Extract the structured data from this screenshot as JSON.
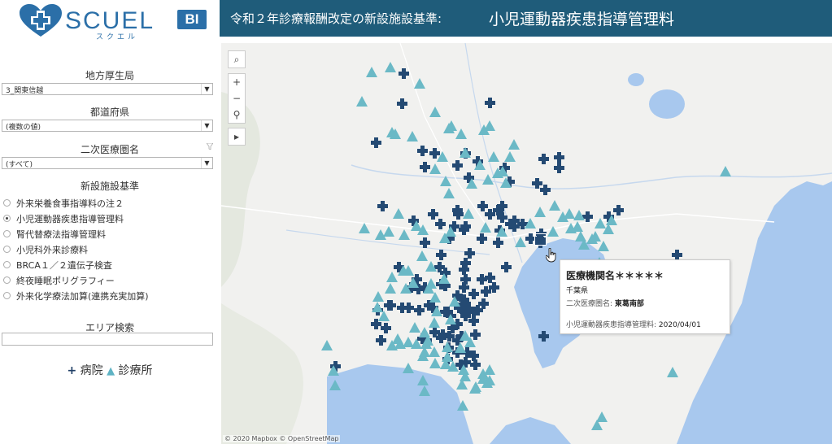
{
  "logo": {
    "brand": "SCUEL",
    "badge": "BI",
    "kana": "スクエル"
  },
  "header": {
    "title": "令和２年診療報酬改定の新設施設基準:",
    "subtitle": "小児運動器疾患指導管理料"
  },
  "filters": {
    "region": {
      "label": "地方厚生局",
      "value": "3_関東信越"
    },
    "prefecture": {
      "label": "都道府県",
      "value": "(複数の値)"
    },
    "medical_area": {
      "label": "二次医療圏名",
      "value": "(すべて)"
    }
  },
  "criteria": {
    "label": "新設施設基準",
    "options": [
      {
        "label": "外来栄養食事指導料の注２",
        "selected": false
      },
      {
        "label": "小児運動器疾患指導管理料",
        "selected": true
      },
      {
        "label": "腎代替療法指導管理料",
        "selected": false
      },
      {
        "label": "小児科外来診療料",
        "selected": false
      },
      {
        "label": "BRCA１／２遺伝子検査",
        "selected": false
      },
      {
        "label": "終夜睡眠ポリグラフィー",
        "selected": false
      },
      {
        "label": "外来化学療法加算(連携充実加算)",
        "selected": false
      }
    ]
  },
  "area_search": {
    "label": "エリア検索",
    "value": ""
  },
  "legend": {
    "hospital": "病院",
    "clinic": "診療所",
    "hospital_color": "#244a73",
    "clinic_color": "#6bb9c6"
  },
  "map": {
    "attribution": "© 2020 Mapbox © OpenStreetMap",
    "controls": [
      "search-icon",
      "zoom-in-icon",
      "zoom-out-icon",
      "pin-icon",
      "expand-icon"
    ]
  },
  "tooltip": {
    "name": "医療機関名＊＊＊＊＊",
    "prefecture": "千葉県",
    "area_label": "二次医療圏名:",
    "area_value": "東葛南部",
    "criterion_label": "小児運動器疾患指導管理料:",
    "criterion_date": "2020/04/01"
  }
}
